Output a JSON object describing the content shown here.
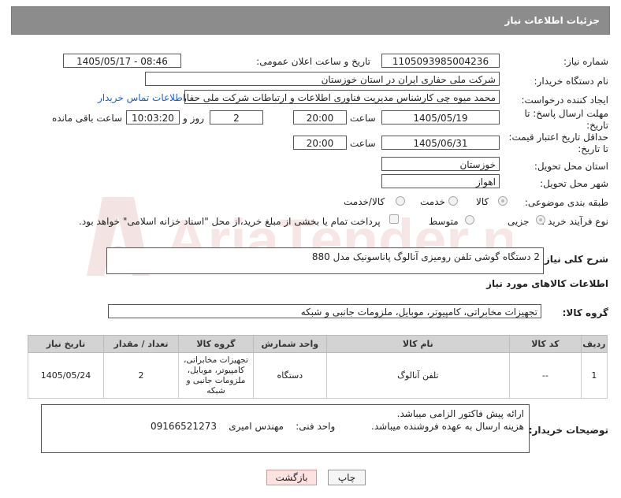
{
  "header": {
    "title": "جزئیات اطلاعات نیاز"
  },
  "fields": {
    "need_number_label": "شماره نیاز:",
    "need_number": "1105093985004236",
    "announce_label": "تاریخ و ساعت اعلان عمومی:",
    "announce_value": "1405/05/17 - 08:46",
    "buyer_org_label": "نام دستگاه خریدار:",
    "buyer_org": "شرکت ملی حفاری ایران در استان خوزستان",
    "requester_label": "ایجاد کننده درخواست:",
    "requester": "محمد میوه چی کارشناس مدیریت فناوری اطلاعات و ارتباطات  شرکت ملی حفاری",
    "buyer_contact_link": "اطلاعات تماس خریدار",
    "deadline_label_1": "مهلت ارسال پاسخ: تا",
    "deadline_label_2": "تاریخ:",
    "deadline_date": "1405/05/19",
    "time_label": "ساعت",
    "deadline_time": "20:00",
    "deadline_days": "2",
    "days_and_label": "روز و",
    "remaining_time": "10:03:20",
    "remaining_label": "ساعت باقی مانده",
    "min_validity_label_1": "حداقل تاریخ اعتبار قیمت:",
    "min_validity_label_2": "تا تاریخ:",
    "validity_date": "1405/06/31",
    "validity_time": "20:00",
    "province_label": "استان محل تحویل:",
    "province": "خوزستان",
    "city_label": "شهر محل تحویل:",
    "city": "اهواز",
    "category_label": "طبقه بندی موضوعی:",
    "category_options": [
      "کالا",
      "خدمت",
      "کالا/خدمت"
    ],
    "process_label": "نوع فرآیند خرید :",
    "process_options": [
      "جزیی",
      "متوسط"
    ],
    "payment_text": "پرداخت تمام یا بخشی از مبلغ خرید،از محل \"اسناد خزانه اسلامی\" خواهد بود.",
    "description_label": "شرح کلی نیاز:",
    "description": "2 دستگاه گوشی تلفن رومیزی  آنالوگ پاناسونیک مدل 880",
    "goods_info_title": "اطلاعات کالاهای مورد نیاز",
    "goods_group_label": "گروه کالا:",
    "goods_group": "تجهیزات مخابراتی، کامپیوتر، موبایل، ملزومات جانبی و شبکه"
  },
  "table": {
    "headers": [
      "ردیف",
      "کد کالا",
      "نام کالا",
      "واحد شمارش",
      "گروه کالا",
      "تعداد / مقدار",
      "تاریخ نیاز"
    ],
    "rows": [
      [
        "1",
        "--",
        "تلفن آنالوگ",
        "دستگاه",
        "تجهیزات مخابراتی، کامپیوتر، موبایل، ملزومات جانبی و شبکه",
        "2",
        "1405/05/24"
      ]
    ]
  },
  "notes": {
    "label": "توضیحات خریدار:",
    "line1": "ارائه پیش فاکتور الزامی میباشد.",
    "line2": "هزینه ارسال به عهده فروشنده میباشد.            واحد فنی:    مهندس امیری    09166521273"
  },
  "buttons": {
    "print": "چاپ",
    "back": "بازگشت"
  },
  "watermark_text": "AriaTender.net",
  "colors": {
    "header_bg": "#8c8c8c",
    "link": "#1f5fbf",
    "back_bg": "#fde2e2"
  }
}
